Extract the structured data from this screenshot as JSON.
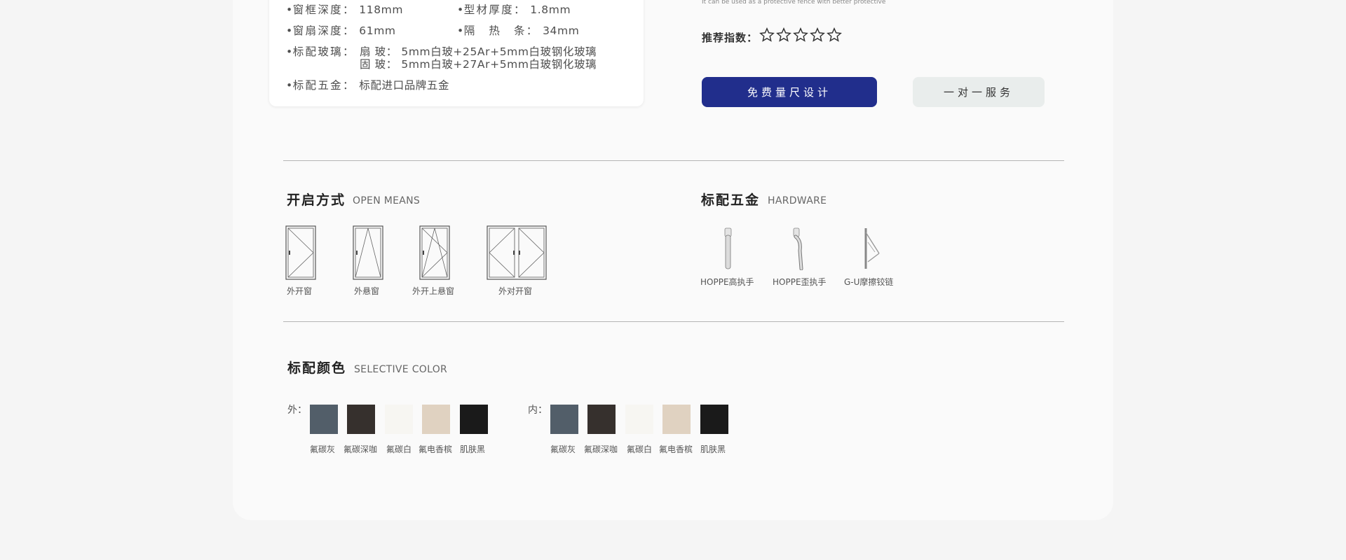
{
  "specs": {
    "frame_depth": {
      "label": "窗框深度：",
      "value": "118mm"
    },
    "profile_thickness": {
      "label": "型材厚度：",
      "value": "1.8mm"
    },
    "sash_depth": {
      "label": "窗扇深度：",
      "value": "61mm"
    },
    "thermal_strip": {
      "label": "隔　热　条：",
      "value": "34mm"
    },
    "glass": {
      "label": "标配玻璃：",
      "sash_prefix": "扇 玻：",
      "sash_value": "5mm白玻+25Ar+5mm白玻钢化玻璃",
      "fixed_prefix": "固 玻：",
      "fixed_value": "5mm白玻+27Ar+5mm白玻钢化玻璃"
    },
    "hardware": {
      "label": "标配五金：",
      "value": "标配进口品牌五金"
    }
  },
  "tagline": "It can be used as a protective fence with better protective",
  "rating": {
    "label": "推荐指数：",
    "stars": 5
  },
  "buttons": {
    "measure": "免费量尺设计",
    "service": "一对一服务"
  },
  "open_means": {
    "title": "开启方式",
    "subtitle": "OPEN MEANS",
    "items": [
      {
        "label": "外开窗",
        "icon": "casement-window-icon"
      },
      {
        "label": "外悬窗",
        "icon": "awning-window-icon"
      },
      {
        "label": "外开上悬窗",
        "icon": "tilt-turn-window-icon"
      },
      {
        "label": "外对开窗",
        "icon": "double-casement-window-icon"
      }
    ]
  },
  "hardware_section": {
    "title": "标配五金",
    "subtitle": "HARDWARE",
    "items": [
      {
        "label": "HOPPE高执手",
        "icon": "high-handle-icon"
      },
      {
        "label": "HOPPE歪执手",
        "icon": "curved-handle-icon"
      },
      {
        "label": "G-U摩擦铰链",
        "icon": "friction-hinge-icon"
      }
    ]
  },
  "colors": {
    "title": "标配颜色",
    "subtitle": "SELECTIVE COLOR",
    "outer_label": "外：",
    "inner_label": "内：",
    "swatches": [
      {
        "name": "氟碳灰",
        "hex": "#525e69"
      },
      {
        "name": "氟碳深咖",
        "hex": "#36302d"
      },
      {
        "name": "氟碳白",
        "hex": "#f7f6f2"
      },
      {
        "name": "氟电香槟",
        "hex": "#e0d2c1"
      },
      {
        "name": "肌肤黑",
        "hex": "#1a1a1a"
      }
    ]
  }
}
